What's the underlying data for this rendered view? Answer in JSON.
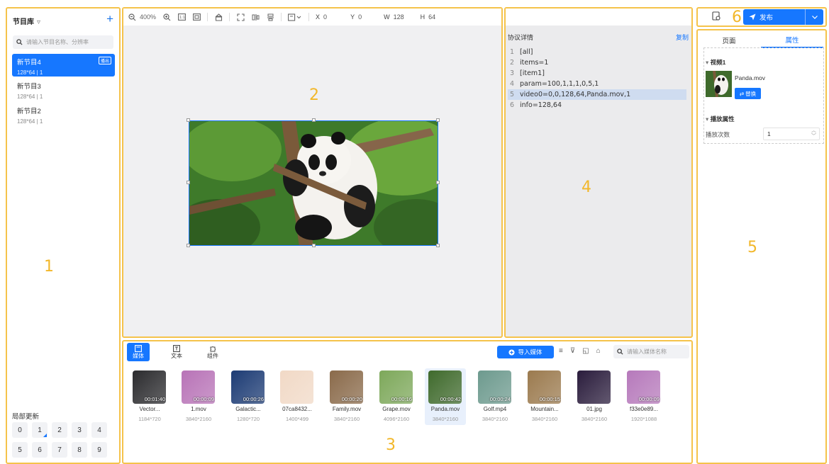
{
  "regions": [
    "1",
    "2",
    "3",
    "4",
    "5",
    "6"
  ],
  "library": {
    "title": "节目库",
    "search_placeholder": "请输入节目名称、分辨率",
    "items": [
      {
        "name": "新节目4",
        "size": "128*64",
        "count": "1",
        "badge": "播出",
        "active": true
      },
      {
        "name": "新节目3",
        "size": "128*64",
        "count": "1",
        "active": false
      },
      {
        "name": "新节目2",
        "size": "128*64",
        "count": "1",
        "active": false
      }
    ],
    "partial_update_label": "局部更新",
    "numbers": [
      "0",
      "1",
      "2",
      "3",
      "4",
      "5",
      "6",
      "7",
      "8",
      "9"
    ]
  },
  "canvas_toolbar": {
    "zoom": "400%",
    "x_label": "X",
    "x_value": "0",
    "y_label": "Y",
    "y_value": "0",
    "w_label": "W",
    "w_value": "128",
    "h_label": "H",
    "h_value": "64"
  },
  "protocol": {
    "title": "协议详情",
    "copy_label": "复制",
    "lines": [
      {
        "n": "1",
        "text": "[all]"
      },
      {
        "n": "2",
        "text": "items=1"
      },
      {
        "n": "3",
        "text": "[item1]"
      },
      {
        "n": "4",
        "text": "param=100,1,1,1,0,5,1"
      },
      {
        "n": "5",
        "text": "video0=0,0,128,64,Panda.mov,1",
        "highlight": true
      },
      {
        "n": "6",
        "text": "info=128,64"
      }
    ]
  },
  "media": {
    "tabs": [
      {
        "label": "媒体",
        "icon": "media-icon",
        "active": true
      },
      {
        "label": "文本",
        "icon": "text-icon",
        "active": false
      },
      {
        "label": "组件",
        "icon": "component-icon",
        "active": false
      }
    ],
    "import_label": "导入媒体",
    "search_placeholder": "请输入媒体名称",
    "items": [
      {
        "name": "Vector...",
        "size": "1184*720",
        "duration": "00:01:40",
        "color": "#2b2b2e"
      },
      {
        "name": "1.mov",
        "size": "3840*2160",
        "duration": "00:00:09",
        "color": "#b873b7"
      },
      {
        "name": "Galactic...",
        "size": "1280*720",
        "duration": "00:00:26",
        "color": "#1c3b74"
      },
      {
        "name": "07ca8432...",
        "size": "1400*499",
        "duration": "",
        "color": "#f1d9c6"
      },
      {
        "name": "Family.mov",
        "size": "3840*2160",
        "duration": "00:00:20",
        "color": "#8a6a4a"
      },
      {
        "name": "Grape.mov",
        "size": "4096*2160",
        "duration": "00:00:16",
        "color": "#7da85a"
      },
      {
        "name": "Panda.mov",
        "size": "3840*2160",
        "duration": "00:00:42",
        "color": "#3f6a2c",
        "selected": true
      },
      {
        "name": "Golf.mp4",
        "size": "3840*2160",
        "duration": "00:00:24",
        "color": "#6d9a8e"
      },
      {
        "name": "Mountain...",
        "size": "3840*2160",
        "duration": "00:00:15",
        "color": "#9b7a4e"
      },
      {
        "name": "01.jpg",
        "size": "3840*2160",
        "duration": "",
        "color": "#2a1c3c"
      },
      {
        "name": "f33e0e89...",
        "size": "1920*1088",
        "duration": "00:00:09",
        "color": "#b679bb"
      }
    ]
  },
  "publish": {
    "label": "发布"
  },
  "properties": {
    "tabs": [
      {
        "label": "页面",
        "active": false
      },
      {
        "label": "属性",
        "active": true
      }
    ],
    "video_section": "视频1",
    "file_name": "Panda.mov",
    "replace_label": "替换",
    "playback_section": "播放属性",
    "play_times_label": "播放次数",
    "play_times_value": "1"
  },
  "colors": {
    "accent": "#1677ff",
    "region_border": "#f5c34b",
    "region_number": "#f2b72a"
  }
}
